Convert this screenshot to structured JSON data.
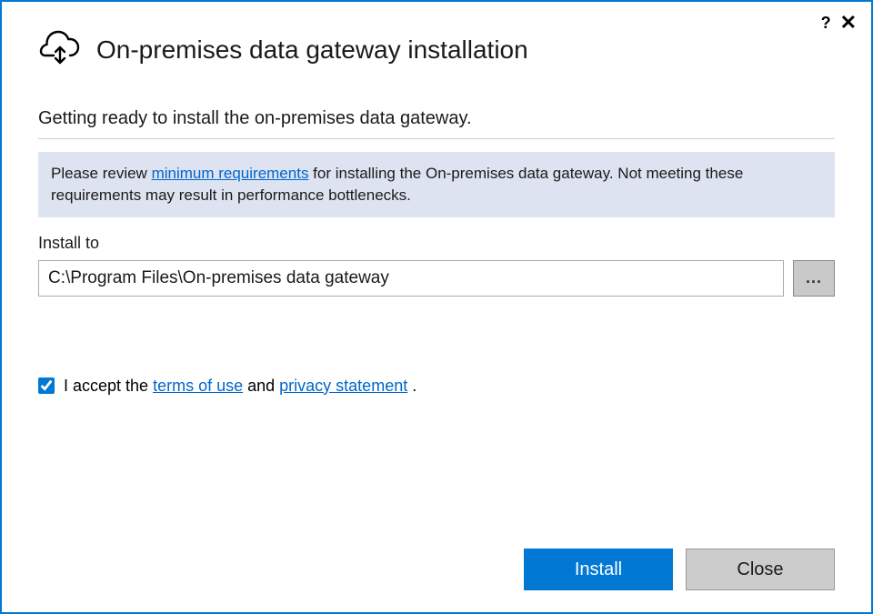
{
  "header": {
    "title": "On-premises data gateway installation"
  },
  "subtitle": "Getting ready to install the on-premises data gateway.",
  "banner": {
    "prefix": "Please review ",
    "link": "minimum requirements",
    "suffix": " for installing the On-premises data gateway. Not meeting these requirements may result in performance bottlenecks."
  },
  "install": {
    "label": "Install to",
    "path": "C:\\Program Files\\On-premises data gateway",
    "browse": "..."
  },
  "accept": {
    "checked": true,
    "prefix": "I accept the ",
    "terms_link": "terms of use",
    "middle": " and ",
    "privacy_link": "privacy statement",
    "suffix": " ."
  },
  "buttons": {
    "install": "Install",
    "close": "Close"
  },
  "titlebar": {
    "help": "?",
    "close": "✕"
  }
}
